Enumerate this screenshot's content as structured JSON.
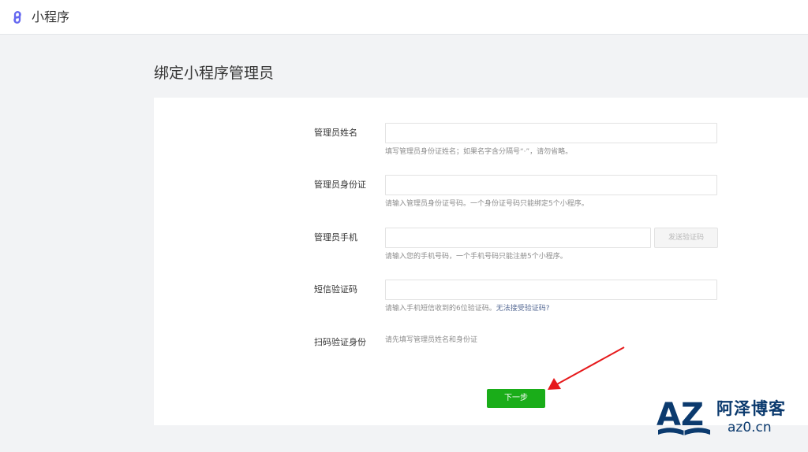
{
  "header": {
    "app_title": "小程序",
    "logo_icon": "miniprogram-logo-icon",
    "accent": "#6467f0"
  },
  "page": {
    "title": "绑定小程序管理员"
  },
  "form": {
    "name": {
      "label": "管理员姓名",
      "value": "",
      "hint": "填写管理员身份证姓名；如果名字含分隔号“·”，请勿省略。"
    },
    "id_card": {
      "label": "管理员身份证",
      "value": "",
      "hint": "请输入管理员身份证号码。一个身份证号码只能绑定5个小程序。"
    },
    "phone": {
      "label": "管理员手机",
      "value": "",
      "send_code_label": "发送验证码",
      "hint": "请输入您的手机号码，一个手机号码只能注册5个小程序。"
    },
    "sms_code": {
      "label": "短信验证码",
      "value": "",
      "hint": "请输入手机短信收到的6位验证码。",
      "hint_link": "无法接受验证码?"
    },
    "scan": {
      "label": "扫码验证身份",
      "text": "请先填写管理员姓名和身份证"
    },
    "next_label": "下一步",
    "next_color": "#1aad19"
  },
  "annotation": {
    "arrow_color": "#e6191b"
  },
  "watermark": {
    "title": "阿泽博客",
    "subtitle": "az0.cn",
    "logo_text": "AZ",
    "color": "#0b3a6e"
  }
}
